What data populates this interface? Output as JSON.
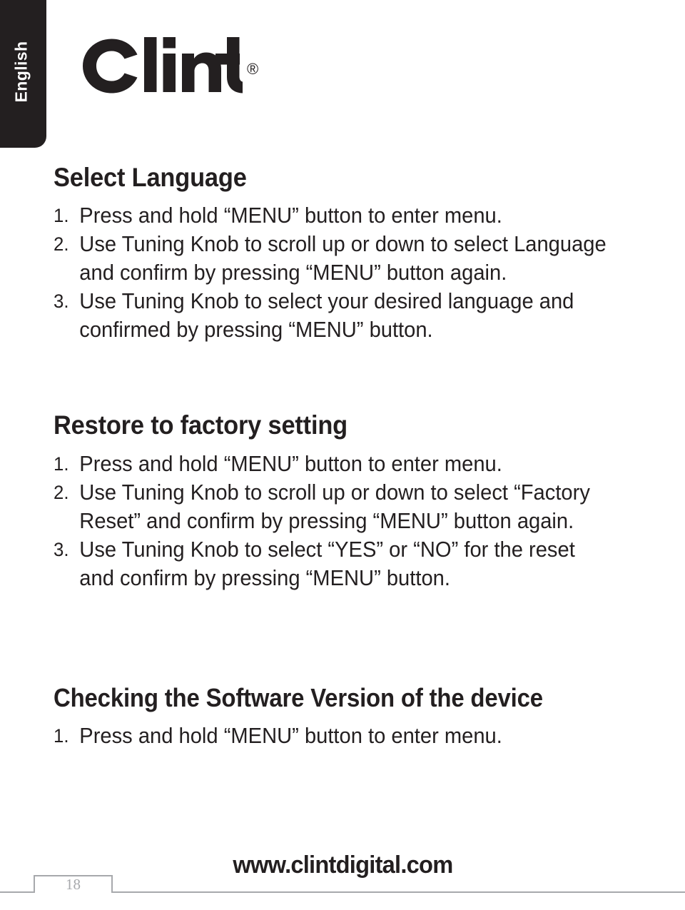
{
  "language_tab": {
    "label": "English"
  },
  "brand": {
    "name": "Clint",
    "registered_mark": "®"
  },
  "sections": [
    {
      "heading": "Select Language",
      "steps": [
        {
          "number": "1.",
          "text": "Press and hold “MENU” button to enter menu."
        },
        {
          "number": "2.",
          "text": "Use Tuning Knob to scroll up or down to select Language and confirm by pressing “MENU” button again."
        },
        {
          "number": "3.",
          "text": "Use Tuning Knob to select your desired language and confirmed by pressing “MENU” button."
        }
      ]
    },
    {
      "heading": "Restore to factory setting",
      "steps": [
        {
          "number": "1.",
          "text": "Press and hold “MENU” button to enter menu."
        },
        {
          "number": "2.",
          "text": "Use Tuning Knob to scroll up or down to select “Factory Reset” and confirm by pressing “MENU” button again."
        },
        {
          "number": "3.",
          "text": "Use Tuning Knob to select “YES” or “NO” for the reset and confirm by pressing “MENU” button."
        }
      ]
    },
    {
      "heading": "Checking the Software Version of the device",
      "steps": [
        {
          "number": "1.",
          "text": "Press and hold “MENU” button to enter menu."
        }
      ]
    }
  ],
  "footer": {
    "url": "www.clintdigital.com",
    "page_number": "18"
  },
  "colors": {
    "ink": "#231f20",
    "footer_gray": "#a7a9ac",
    "page_background": "#ffffff"
  }
}
